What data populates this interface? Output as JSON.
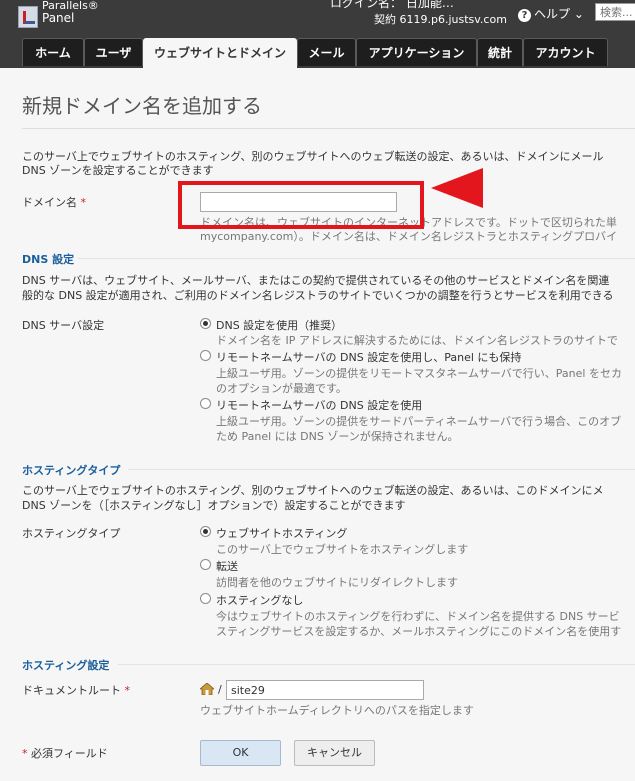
{
  "header": {
    "logo_line1": "Parallels®",
    "logo_line2": "Panel",
    "login_text": "ログイン名： 日加能…",
    "contract_text": "契約 6119.p6.justsv.com",
    "help_label": "ヘルプ ⌄",
    "search_placeholder": "検索..."
  },
  "tabs": [
    {
      "label": "ホーム"
    },
    {
      "label": "ユーザ"
    },
    {
      "label": "ウェブサイトとドメイン",
      "active": true
    },
    {
      "label": "メール"
    },
    {
      "label": "アプリケーション"
    },
    {
      "label": "統計"
    },
    {
      "label": "アカウント"
    }
  ],
  "page": {
    "title": "新規ドメイン名を追加する",
    "intro_line1": "このサーバ上でウェブサイトのホスティング、別のウェブサイトへのウェブ転送の設定、あるいは、ドメインにメール",
    "intro_line2": "DNS ゾーンを設定することができます"
  },
  "domain_field": {
    "label": "ドメイン名",
    "required_mark": "*",
    "value": "",
    "hint_line1": "ドメイン名は、ウェブサイトのインターネットアドレスです。ドットで区切られた単",
    "hint_line2": "mycompany.com）。ドメイン名は、ドメイン名レジストラとホスティングプロバイ"
  },
  "dns_section": {
    "heading": "DNS 設定",
    "desc_line1": "DNS サーバは、ウェブサイト、メールサーバ、またはこの契約で提供されているその他のサービスとドメイン名を関連",
    "desc_line2": "般的な DNS 設定が適用され、ご利用のドメイン名レジストラのサイトでいくつかの調整を行うとサービスを利用できる",
    "field_label": "DNS サーバ設定",
    "options": [
      {
        "label": "DNS 設定を使用（推奨）",
        "checked": true,
        "hint_line1": "ドメイン名を IP アドレスに解決するためには、ドメイン名レジストラのサイトで",
        "hint_line2": ""
      },
      {
        "label": "リモートネームサーバの DNS 設定を使用し、Panel にも保持",
        "checked": false,
        "hint_line1": "上級ユーザ用。ゾーンの提供をリモートマスタネームサーバで行い、Panel をセカ",
        "hint_line2": "のオプションが最適です。"
      },
      {
        "label": "リモートネームサーバの DNS 設定を使用",
        "checked": false,
        "hint_line1": "上級ユーザ用。ゾーンの提供をサードパーティネームサーバで行う場合、このオブ",
        "hint_line2": "ため Panel には DNS ゾーンが保持されません。"
      }
    ]
  },
  "hosting_type_section": {
    "heading": "ホスティングタイプ",
    "desc_line1": "このサーバ上でウェブサイトのホスティング、別のウェブサイトへのウェブ転送の設定、あるいは、このドメインにメ",
    "desc_line2": "DNS ゾーンを（［ホスティングなし］オプションで）設定することができます",
    "field_label": "ホスティングタイプ",
    "options": [
      {
        "label": "ウェブサイトホスティング",
        "checked": true,
        "hint_line1": "このサーバ上でウェブサイトをホスティングします",
        "hint_line2": ""
      },
      {
        "label": "転送",
        "checked": false,
        "hint_line1": "訪問者を他のウェブサイトにリダイレクトします",
        "hint_line2": ""
      },
      {
        "label": "ホスティングなし",
        "checked": false,
        "hint_line1": "今はウェブサイトのホスティングを行わずに、ドメイン名を提供する DNS サービ",
        "hint_line2": "スティングサービスを設定するか、メールホスティングにこのドメイン名を使用す"
      }
    ]
  },
  "hosting_settings_section": {
    "heading": "ホスティング設定",
    "docroot_label": "ドキュメントルート",
    "docroot_required": "*",
    "docroot_prefix": "/",
    "docroot_value": "site29",
    "docroot_hint": "ウェブサイトホームディレクトリへのパスを指定します"
  },
  "footer": {
    "required_mark": "*",
    "required_note": "必須フィールド",
    "ok_label": "OK",
    "cancel_label": "キャンセル"
  },
  "colors": {
    "header_bg": "#3b3b3b",
    "section_heading": "#1a5f9c",
    "annotation_red": "#e2161c"
  }
}
